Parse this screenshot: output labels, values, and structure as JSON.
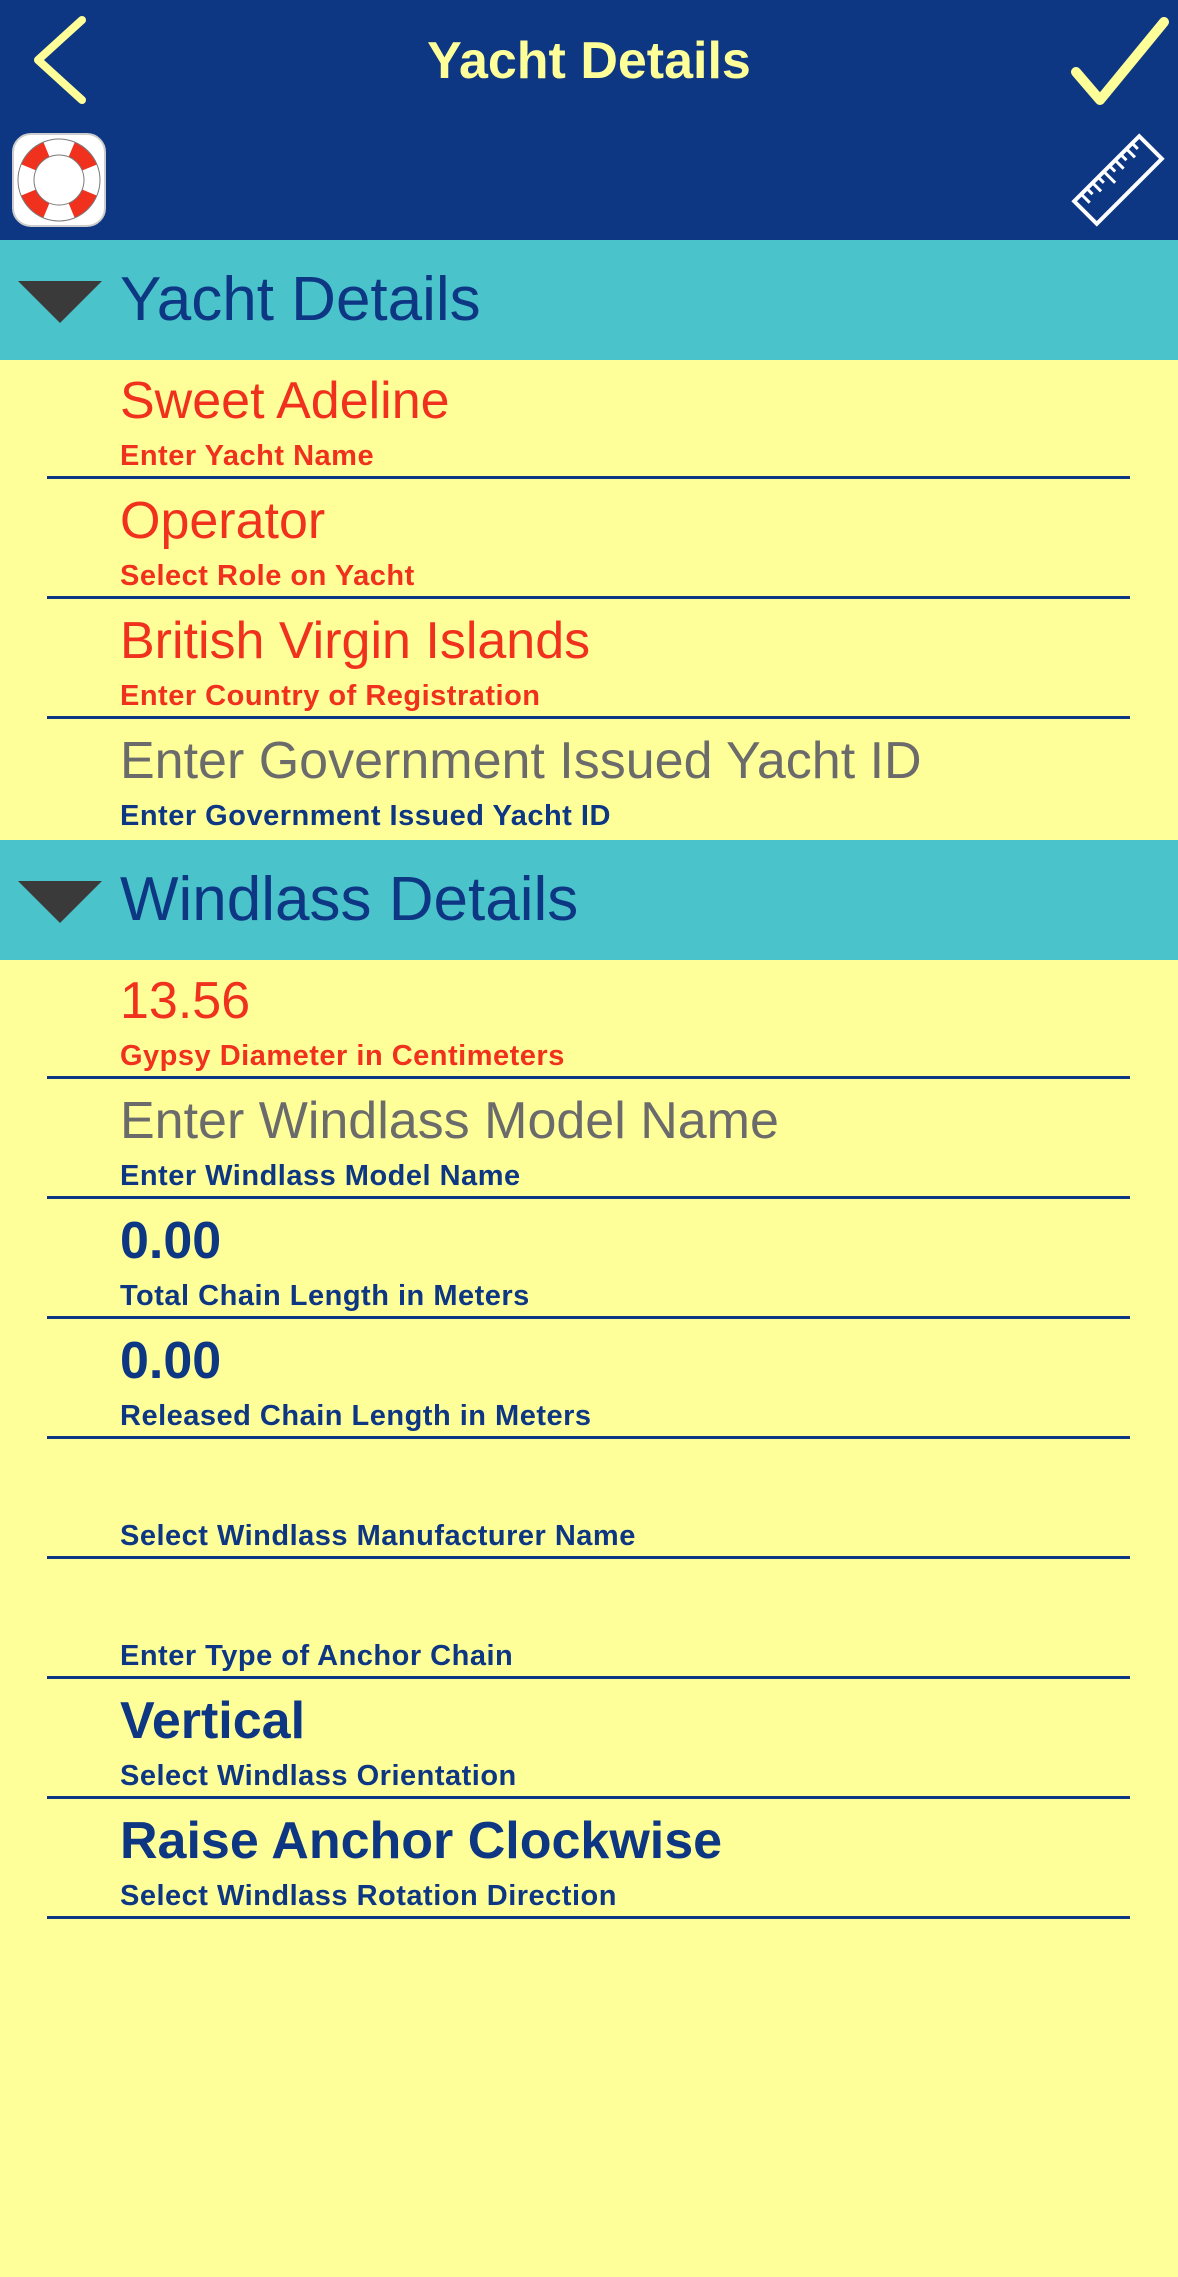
{
  "header": {
    "title": "Yacht Details",
    "back_icon": "chevron-left-icon",
    "done_icon": "checkmark-icon",
    "help_icon": "life-ring-icon",
    "measure_icon": "ruler-icon"
  },
  "colors": {
    "header_bg": "#0d3683",
    "section_bg": "#4ac3ca",
    "page_bg": "#ffff99",
    "accent_red": "#f0311e",
    "navy": "#0d3683",
    "placeholder_grey": "#6b6b6b"
  },
  "sections": {
    "yacht": {
      "title": "Yacht Details",
      "fields": {
        "name": {
          "value": "Sweet Adeline",
          "label": "Enter Yacht Name"
        },
        "role": {
          "value": "Operator",
          "label": "Select Role on Yacht"
        },
        "country": {
          "value": "British Virgin Islands",
          "label": "Enter Country of Registration"
        },
        "gov_id": {
          "placeholder": "Enter Government Issued Yacht ID",
          "label": "Enter Government Issued Yacht ID"
        }
      }
    },
    "windlass": {
      "title": "Windlass Details",
      "fields": {
        "gypsy": {
          "value": "13.56",
          "label": "Gypsy Diameter in Centimeters"
        },
        "model": {
          "placeholder": "Enter Windlass Model Name",
          "label": "Enter Windlass Model Name"
        },
        "total_chain": {
          "value": "0.00",
          "label": "Total Chain Length in Meters"
        },
        "released_chain": {
          "value": "0.00",
          "label": "Released Chain Length in Meters"
        },
        "manufacturer": {
          "value": "",
          "label": "Select Windlass Manufacturer Name"
        },
        "chain_type": {
          "value": "",
          "label": "Enter Type of Anchor Chain"
        },
        "orientation": {
          "value": "Vertical",
          "label": "Select Windlass Orientation"
        },
        "rotation": {
          "value": "Raise Anchor Clockwise",
          "label": "Select Windlass Rotation Direction"
        }
      }
    }
  }
}
